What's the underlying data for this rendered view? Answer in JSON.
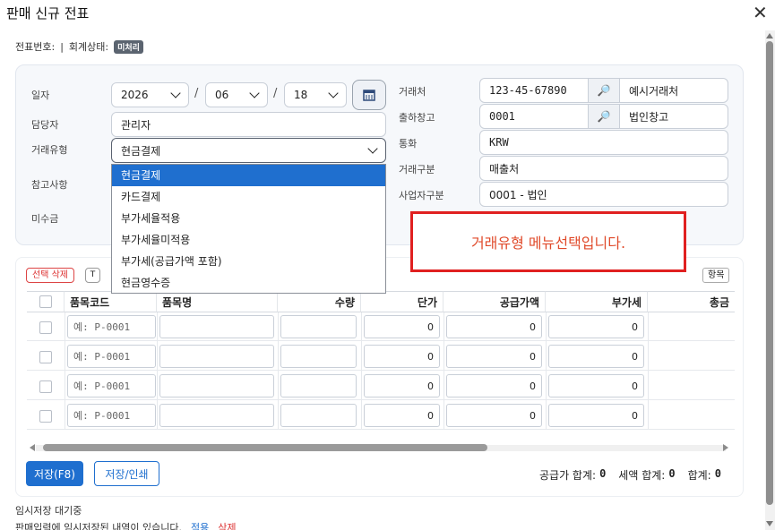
{
  "window": {
    "title": "판매 신규 전표",
    "close_icon": "close-icon"
  },
  "meta": {
    "slip_no_label": "전표번호:",
    "separator": "|",
    "acct_status_label": "회계상태:",
    "acct_status_badge": "미처리"
  },
  "form": {
    "date_label": "일자",
    "year": "2026",
    "month": "06",
    "day": "18",
    "date_sep": "/",
    "manager_label": "담당자",
    "manager_value": "관리자",
    "trade_type_label": "거래유형",
    "trade_type_value": "현금결제",
    "note_label": "참고사항",
    "unpaid_label": "미수금",
    "client_label": "거래처",
    "client_code": "123-45-67890",
    "client_name": "예시거래처",
    "warehouse_label": "출하창고",
    "warehouse_code": "0001",
    "warehouse_name": "법인창고",
    "currency_label": "통화",
    "currency_value": "KRW",
    "trade_class_label": "거래구분",
    "trade_class_value": "매출처",
    "biz_class_label": "사업자구분",
    "biz_class_value": "0001 - 법인"
  },
  "dropdown": {
    "options": [
      "현금결제",
      "카드결제",
      "부가세율적용",
      "부가세율미적용",
      "부가세(공급가액 포함)",
      "현금영수증"
    ],
    "selected_index": 0
  },
  "notice": {
    "text": "거래유형 메뉴선택입니다."
  },
  "grid": {
    "delete_selected": "선택 삭제",
    "t_button": "T",
    "items_button": "항목",
    "headers": [
      "품목코드",
      "품목명",
      "수량",
      "단가",
      "공급가액",
      "부가세",
      "총금"
    ],
    "code_placeholder": "예: P-0001",
    "rows": [
      {
        "unit_price": "0",
        "supply": "0",
        "vat": "0"
      },
      {
        "unit_price": "0",
        "supply": "0",
        "vat": "0"
      },
      {
        "unit_price": "0",
        "supply": "0",
        "vat": "0"
      },
      {
        "unit_price": "0",
        "supply": "0",
        "vat": "0"
      }
    ]
  },
  "actions": {
    "save": "저장(F8)",
    "save_print": "저장/인쇄"
  },
  "totals": {
    "supply_label": "공급가 합계:",
    "supply_value": "0",
    "tax_label": "세액 합계:",
    "tax_value": "0",
    "sum_label": "합계:",
    "sum_value": "0"
  },
  "temp": {
    "waiting": "임시저장 대기중",
    "message": "판매입력에 임시저장된 내역이 있습니다.",
    "apply": "적용",
    "delete": "삭제"
  },
  "colors": {
    "accent": "#1f6fcf",
    "danger": "#e02020",
    "selected_option": "#1f6fcf"
  }
}
